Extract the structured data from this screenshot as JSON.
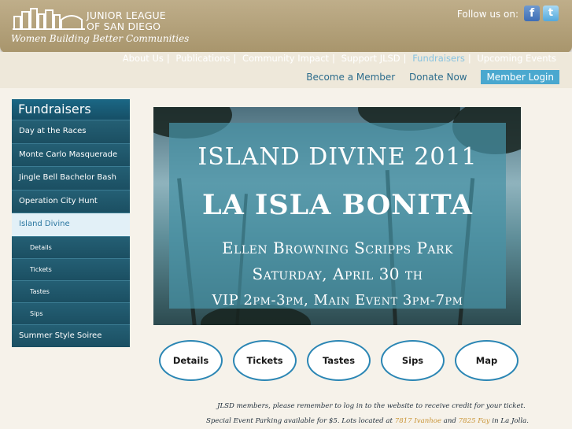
{
  "header": {
    "org_name_line1": "JUNIOR LEAGUE",
    "org_name_line2": "OF SAN DIEGO",
    "tagline": "Women Building Better Communities",
    "follow_label": "Follow us on:",
    "social": [
      {
        "name": "facebook-icon",
        "glyph": "f",
        "color": "#3e6db5"
      },
      {
        "name": "twitter-icon",
        "glyph": "t",
        "color": "#53a8dd"
      }
    ]
  },
  "topnav": {
    "items": [
      "About Us",
      "Publications",
      "Community Impact",
      "Support JLSD",
      "Fundraisers",
      "Upcoming Events"
    ],
    "active_index": 4
  },
  "subnav": {
    "become_member": "Become a Member",
    "donate": "Donate Now",
    "login": "Member Login"
  },
  "sidebar": {
    "title": "Fundraisers",
    "items": [
      {
        "label": "Day at the Races",
        "type": "main",
        "active": false
      },
      {
        "label": "Monte Carlo Masquerade",
        "type": "main",
        "active": false
      },
      {
        "label": "Jingle Bell Bachelor Bash",
        "type": "main",
        "active": false
      },
      {
        "label": "Operation City Hunt",
        "type": "main",
        "active": false
      },
      {
        "label": "Island Divine",
        "type": "main",
        "active": true
      },
      {
        "label": "Details",
        "type": "sub",
        "active": false
      },
      {
        "label": "Tickets",
        "type": "sub",
        "active": false
      },
      {
        "label": "Tastes",
        "type": "sub",
        "active": false
      },
      {
        "label": "Sips",
        "type": "sub",
        "active": false
      },
      {
        "label": "Summer Style Soiree",
        "type": "main",
        "active": false
      }
    ]
  },
  "banner": {
    "line1": "ISLAND DIVINE 2011",
    "line2": "LA ISLA BONITA",
    "line3": "Ellen Browning Scripps Park",
    "line4": "Saturday, April 30 th",
    "line5": "VIP 2pm-3pm, Main Event 3pm-7pm"
  },
  "buttons": [
    "Details",
    "Tickets",
    "Tastes",
    "Sips",
    "Map"
  ],
  "notes": {
    "line1": "JLSD members, please remember to log in to the website to receive credit for your ticket.",
    "line2_prefix": "Special Event Parking available for $5.  Lots located at ",
    "addr1": "7817 Ivanhoe",
    "line2_mid": " and ",
    "addr2": "7825 Fay",
    "line2_suffix": " in La Jolla."
  },
  "colors": {
    "header_bg": "#a8956c",
    "sidebar_bg": "#1d5a70",
    "accent": "#4aa8cf",
    "oval_border": "#2b86b4",
    "active_nav": "#87c3e0",
    "address_link": "#c99435"
  }
}
